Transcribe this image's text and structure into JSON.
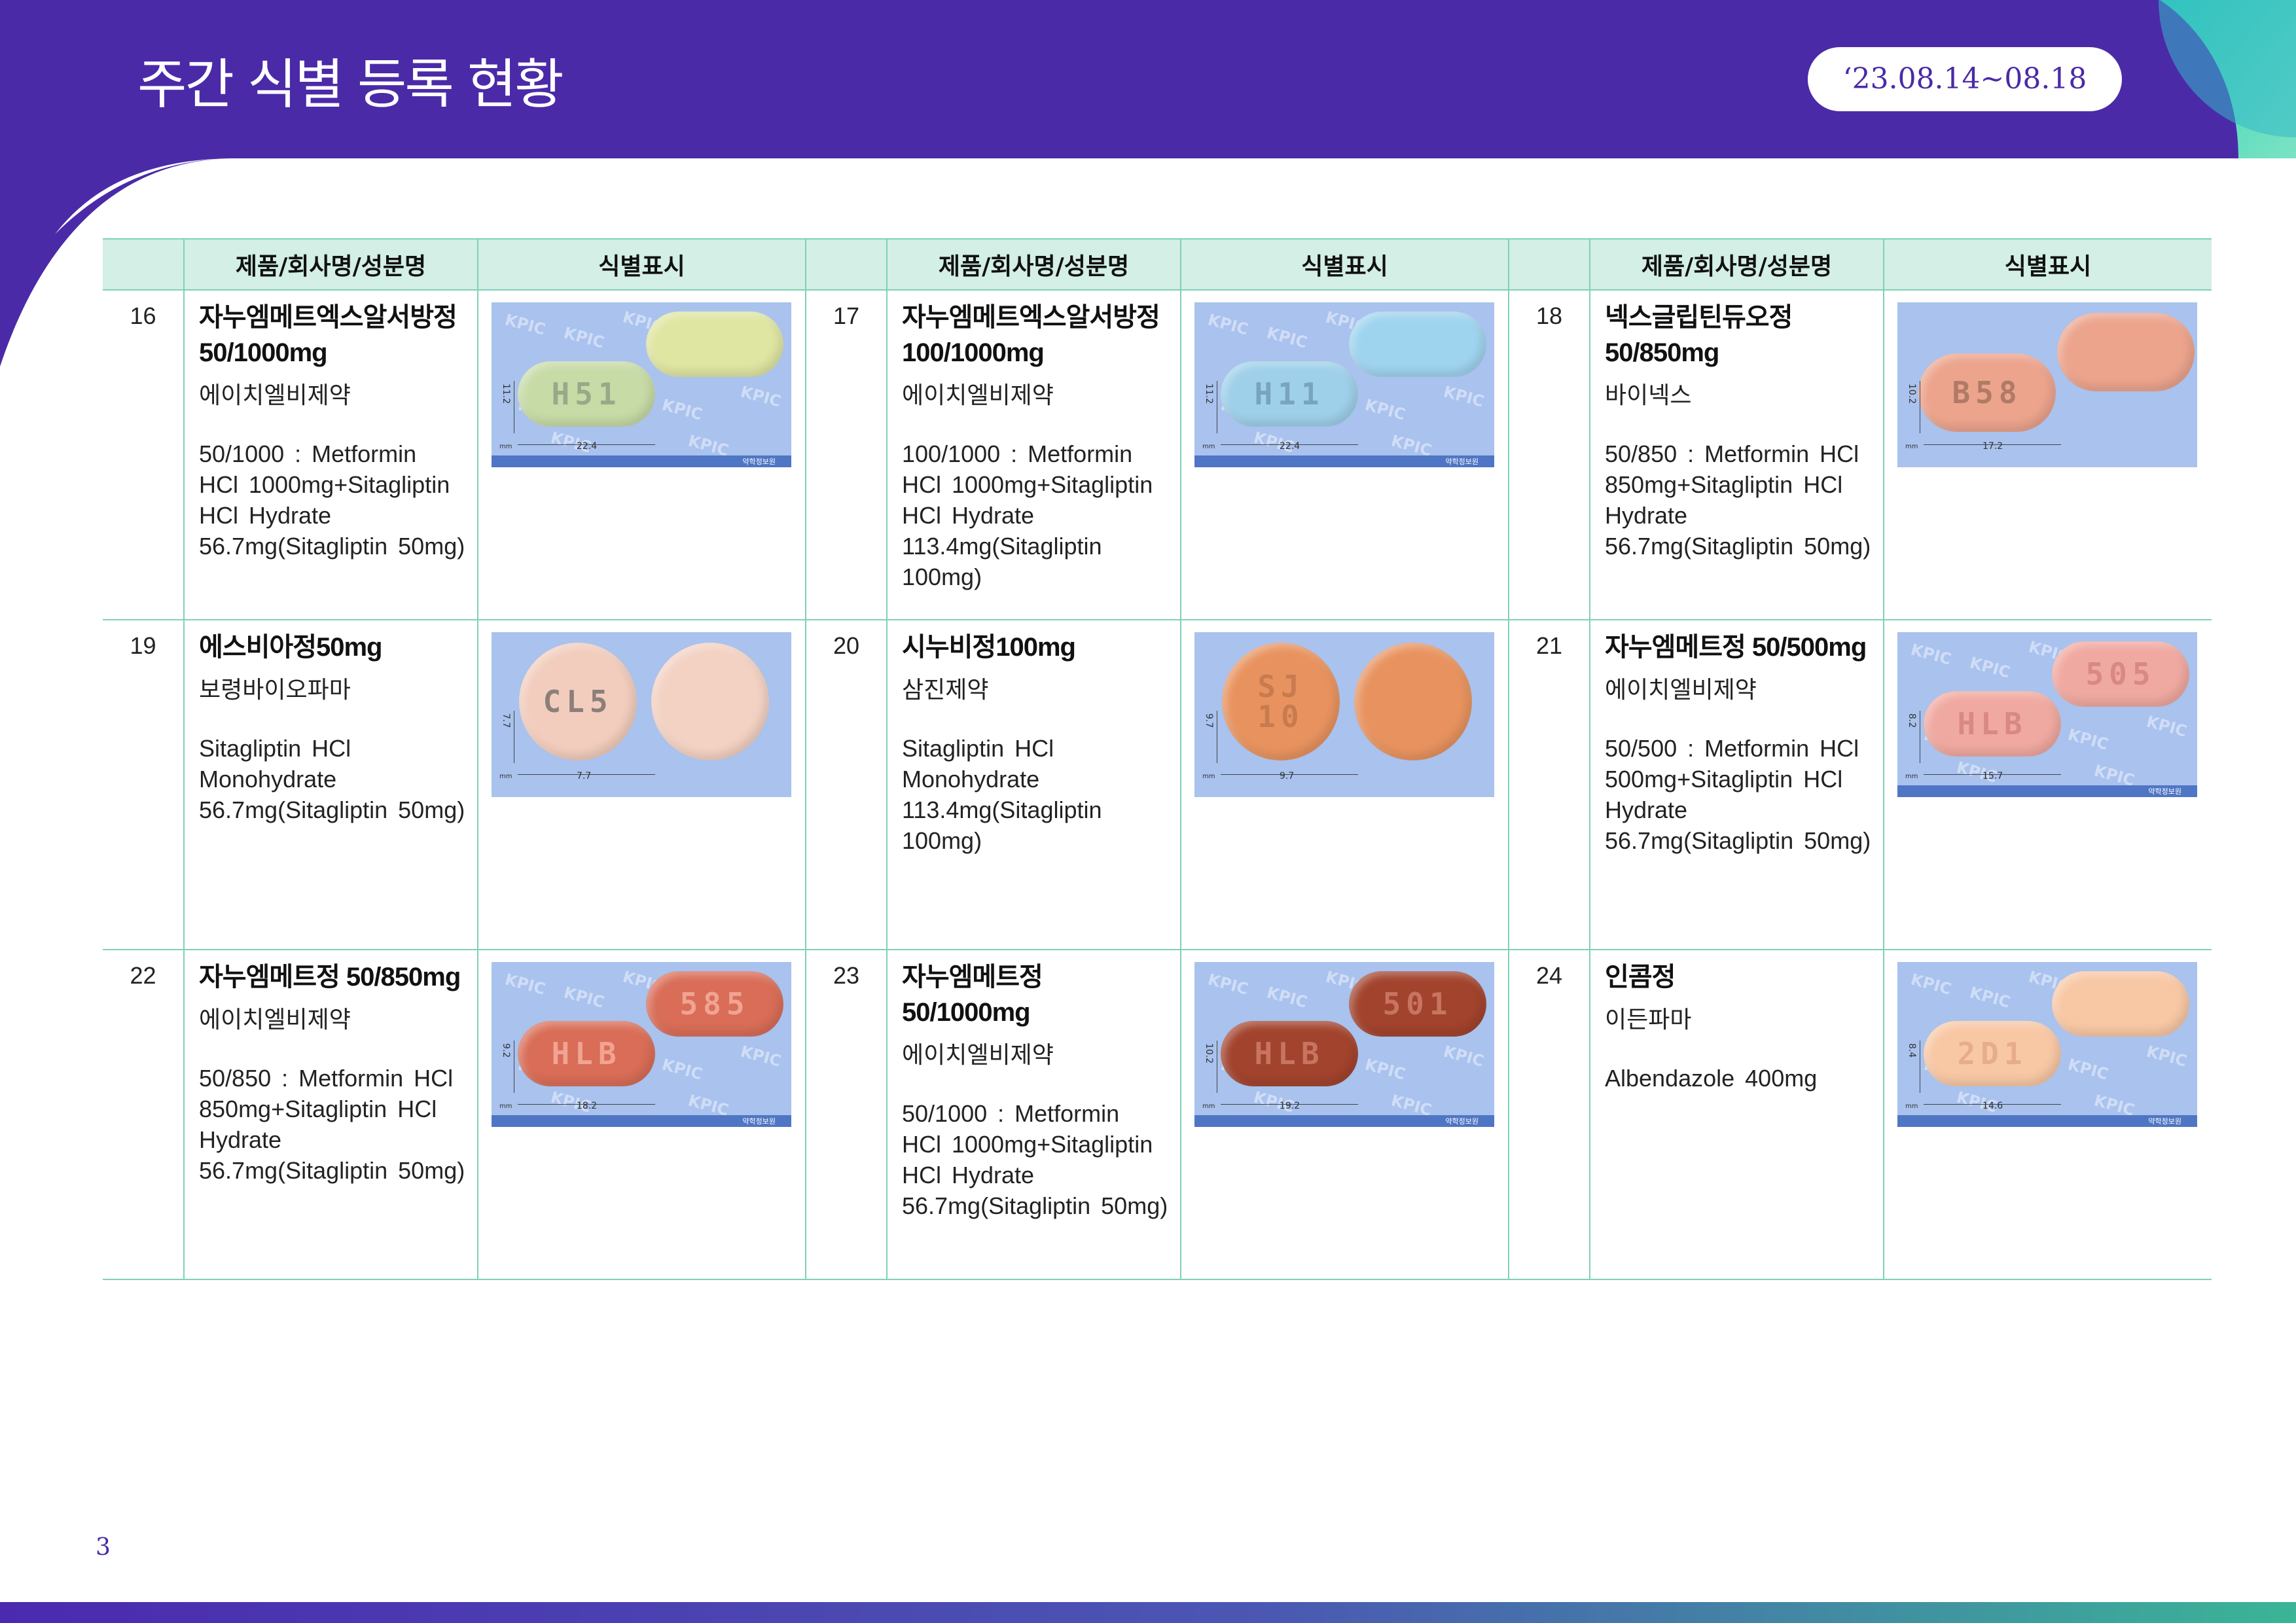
{
  "header": {
    "title": "주간 식별 등록 현황",
    "date_range": "‘23.08.14~08.18"
  },
  "table": {
    "columns": [
      "제품/회사명/성분명",
      "식별표시"
    ],
    "rows": [
      [
        {
          "no": "16",
          "name": "자누엠메트엑스알서방정 50/1000mg",
          "company": "에이치엘비제약",
          "ingredient": "50/1000 : Metformin HCl 1000mg+Sitagliptin HCl Hydrate 56.7mg(Sitagliptin 50mg)",
          "image": {
            "width_label": "22.4",
            "height_label": "11.2",
            "mm_label": "mm",
            "brand": "약학정보원",
            "watermark": "KPIC",
            "pills": [
              {
                "imprint": "",
                "color": "#dfe6a2",
                "shape": "oblong",
                "pos": "back"
              },
              {
                "imprint": "H51",
                "color": "#c7dba7",
                "shape": "oblong",
                "pos": "front",
                "ink": "#9aa88a"
              }
            ]
          }
        },
        {
          "no": "17",
          "name": "자누엠메트엑스알서방정 100/1000mg",
          "company": "에이치엘비제약",
          "ingredient": "100/1000 : Metformin HCl 1000mg+Sitagliptin HCl Hydrate 113.4mg(Sitagliptin 100mg)",
          "image": {
            "width_label": "22.4",
            "height_label": "11.2",
            "mm_label": "mm",
            "brand": "약학정보원",
            "watermark": "KPIC",
            "pills": [
              {
                "imprint": "",
                "color": "#9fd4ef",
                "shape": "oblong",
                "pos": "back"
              },
              {
                "imprint": "H11",
                "color": "#9fd0ea",
                "shape": "oblong",
                "pos": "front",
                "ink": "#79a4bd"
              }
            ]
          }
        },
        {
          "no": "18",
          "name": "넥스글립틴듀오정 50/850mg",
          "company": "바이넥스",
          "ingredient": "50/850 : Metformin HCl 850mg+Sitagliptin HCl Hydrate 56.7mg(Sitagliptin 50mg)",
          "image": {
            "width_label": "17.2",
            "height_label": "10.2",
            "mm_label": "mm",
            "brand": "",
            "watermark": "",
            "pills": [
              {
                "imprint": "",
                "color": "#eca48d",
                "shape": "oval",
                "pos": "back"
              },
              {
                "imprint": "B58",
                "color": "#eca48d",
                "shape": "oval",
                "pos": "front",
                "ink": "#b07a66"
              }
            ]
          }
        }
      ],
      [
        {
          "no": "19",
          "name": "에스비아정50mg",
          "company": "보령바이오파마",
          "ingredient": "Sitagliptin HCl Monohydrate 56.7mg(Sitagliptin 50mg)",
          "image": {
            "width_label": "7.7",
            "height_label": "7.7",
            "mm_label": "mm",
            "brand": "",
            "watermark": "",
            "pills": [
              {
                "imprint": "CL5",
                "color": "#f2cdbd",
                "shape": "round",
                "pos": "left",
                "ink": "#8c7f7a"
              },
              {
                "imprint": "",
                "color": "#f3d2c3",
                "shape": "round",
                "pos": "right"
              }
            ]
          }
        },
        {
          "no": "20",
          "name": "시누비정100mg",
          "company": "삼진제약",
          "ingredient": "Sitagliptin HCl Monohydrate 113.4mg(Sitagliptin 100mg)",
          "image": {
            "width_label": "9.7",
            "height_label": "9.7",
            "mm_label": "mm",
            "brand": "",
            "watermark": "",
            "pills": [
              {
                "imprint": "SJ10",
                "color": "#e8935f",
                "shape": "round",
                "pos": "left",
                "ink": "#c87b4f"
              },
              {
                "imprint": "",
                "color": "#e8935f",
                "shape": "round",
                "pos": "right"
              }
            ]
          }
        },
        {
          "no": "21",
          "name": "자누엠메트정 50/500mg",
          "company": "에이치엘비제약",
          "ingredient": "50/500 : Metformin HCl 500mg+Sitagliptin HCl Hydrate 56.7mg(Sitagliptin 50mg)",
          "image": {
            "width_label": "15.7",
            "height_label": "8.2",
            "mm_label": "mm",
            "brand": "약학정보원",
            "watermark": "KPIC",
            "pills": [
              {
                "imprint": "505",
                "color": "#f0a9a0",
                "shape": "oblong",
                "pos": "back",
                "ink": "#d88982"
              },
              {
                "imprint": "HLB",
                "color": "#f0a9a0",
                "shape": "oblong",
                "pos": "front",
                "ink": "#d88982"
              }
            ]
          }
        }
      ],
      [
        {
          "no": "22",
          "name": "자누엠메트정 50/850mg",
          "company": "에이치엘비제약",
          "ingredient": "50/850 : Metformin HCl 850mg+Sitagliptin HCl Hydrate 56.7mg(Sitagliptin 50mg)",
          "image": {
            "width_label": "18.2",
            "height_label": "9.2",
            "mm_label": "mm",
            "brand": "약학정보원",
            "watermark": "KPIC",
            "pills": [
              {
                "imprint": "585",
                "color": "#d96d57",
                "shape": "oblong",
                "pos": "back",
                "ink": "#f0a491"
              },
              {
                "imprint": "HLB",
                "color": "#d96d57",
                "shape": "oblong",
                "pos": "front",
                "ink": "#f0a491"
              }
            ]
          }
        },
        {
          "no": "23",
          "name": "자누엠메트정 50/1000mg",
          "company": "에이치엘비제약",
          "ingredient": "50/1000 : Metformin HCl 1000mg+Sitagliptin HCl Hydrate 56.7mg(Sitagliptin 50mg)",
          "image": {
            "width_label": "19.2",
            "height_label": "10.2",
            "mm_label": "mm",
            "brand": "약학정보원",
            "watermark": "KPIC",
            "pills": [
              {
                "imprint": "501",
                "color": "#a2432d",
                "shape": "oblong",
                "pos": "back",
                "ink": "#c77461"
              },
              {
                "imprint": "HLB",
                "color": "#a2432d",
                "shape": "oblong",
                "pos": "front",
                "ink": "#c77461"
              }
            ]
          }
        },
        {
          "no": "24",
          "name": "인콤정",
          "company": "이든파마",
          "ingredient": "Albendazole 400mg",
          "image": {
            "width_label": "14.6",
            "height_label": "8.4",
            "mm_label": "mm",
            "brand": "약학정보원",
            "watermark": "KPIC",
            "pills": [
              {
                "imprint": "",
                "color": "#f8c8a5",
                "shape": "oblong",
                "pos": "back"
              },
              {
                "imprint": "2D1",
                "color": "#f8c8a5",
                "shape": "oblong",
                "pos": "front",
                "ink": "#e7ac8c"
              }
            ]
          }
        }
      ]
    ]
  },
  "page_number": "3",
  "colors": {
    "header_purple": "#4b2aa8",
    "accent_teal": "#3dd3a8",
    "table_header_bg": "#d3efe6",
    "border": "#7fd1b7",
    "photo_bg": "#a9c2ee"
  }
}
